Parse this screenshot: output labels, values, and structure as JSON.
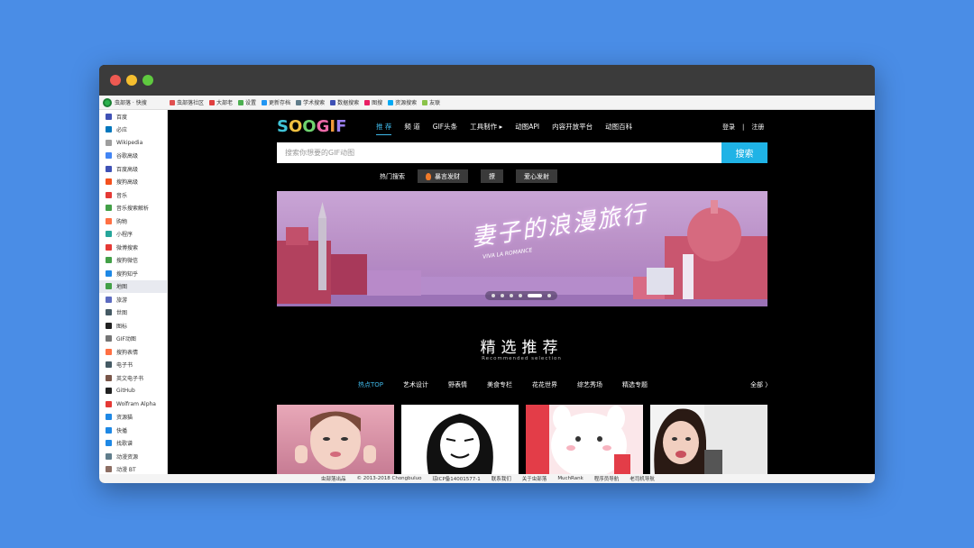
{
  "bookmarks_bar": {
    "brand_name": "虫部落 · 快搜",
    "items": [
      {
        "label": "虫部落社区",
        "color": "#e05050"
      },
      {
        "label": "大部老",
        "color": "#e04040"
      },
      {
        "label": "设置",
        "color": "#4caf50"
      },
      {
        "label": "更新存档",
        "color": "#2196f3"
      },
      {
        "label": "学术搜索",
        "color": "#607d8b"
      },
      {
        "label": "数据搜索",
        "color": "#3f51b5"
      },
      {
        "label": "图搜",
        "color": "#e91e63"
      },
      {
        "label": "资源搜索",
        "color": "#03a9f4"
      },
      {
        "label": "友联",
        "color": "#8bc34a"
      }
    ]
  },
  "sidebar": {
    "items": [
      {
        "label": "百度",
        "color": "#3f51b5"
      },
      {
        "label": "必应",
        "color": "#0277bd"
      },
      {
        "label": "Wikipedia",
        "color": "#9e9e9e"
      },
      {
        "label": "谷歌高级",
        "color": "#4285f4"
      },
      {
        "label": "百度高级",
        "color": "#3f51b5"
      },
      {
        "label": "搜狗高级",
        "color": "#f4511e"
      },
      {
        "label": "音乐",
        "color": "#e53935"
      },
      {
        "label": "音乐搜索解析",
        "color": "#43a047"
      },
      {
        "label": "购物",
        "color": "#ff7043"
      },
      {
        "label": "小程序",
        "color": "#26a69a"
      },
      {
        "label": "微博搜索",
        "color": "#e53935"
      },
      {
        "label": "搜狗微信",
        "color": "#43a047"
      },
      {
        "label": "搜狗知乎",
        "color": "#1e88e5"
      },
      {
        "label": "地图",
        "color": "#43a047",
        "active": true
      },
      {
        "label": "旅游",
        "color": "#5c6bc0"
      },
      {
        "label": "世图",
        "color": "#455a64"
      },
      {
        "label": "图标",
        "color": "#212121"
      },
      {
        "label": "GIF动图",
        "color": "#757575"
      },
      {
        "label": "搜狗表情",
        "color": "#ff7043"
      },
      {
        "label": "电子书",
        "color": "#455a64"
      },
      {
        "label": "英文电子书",
        "color": "#795548"
      },
      {
        "label": "GitHub",
        "color": "#212121"
      },
      {
        "label": "Wolfram Alpha",
        "color": "#e53935"
      },
      {
        "label": "资源猫",
        "color": "#1e88e5"
      },
      {
        "label": "快播",
        "color": "#1e88e5"
      },
      {
        "label": "找歌谱",
        "color": "#1e88e5"
      },
      {
        "label": "动漫资源",
        "color": "#607d8b"
      },
      {
        "label": "动漫 BT",
        "color": "#8d6e63"
      }
    ]
  },
  "site": {
    "logo_letters": [
      "S",
      "O",
      "O",
      "G",
      "I",
      "F"
    ],
    "nav": [
      {
        "label": "推 荐",
        "active": true
      },
      {
        "label": "频 道"
      },
      {
        "label": "GIF头条"
      },
      {
        "label": "工具制作 ▸"
      },
      {
        "label": "动图API"
      },
      {
        "label": "内容开放平台"
      },
      {
        "label": "动图百科"
      }
    ],
    "login": "登录",
    "auth_sep": "|",
    "register": "注册",
    "search_placeholder": "搜索你想要的GIF动图",
    "search_button": "搜索",
    "hot_label": "热门搜索",
    "hot_tags": [
      "暴言发财",
      "撩",
      "爱心发射"
    ]
  },
  "banner": {
    "title": "妻子的浪漫旅行",
    "subtitle": "VIVA LA ROMANCE",
    "slide_count": 6,
    "active_slide": 5
  },
  "section": {
    "title": "精选推荐",
    "subtitle": "Recommended selection",
    "categories": [
      {
        "label": "热点TOP",
        "active": true
      },
      {
        "label": "艺术设计"
      },
      {
        "label": "野表情"
      },
      {
        "label": "美食专栏"
      },
      {
        "label": "花花世界"
      },
      {
        "label": "综艺秀场"
      },
      {
        "label": "精选专题"
      }
    ],
    "all_label": "全部 〉"
  },
  "footer": {
    "items": [
      "虫部落出品",
      "© 2013-2018 Chongbuluo",
      "琼ICP备14001577-1",
      "联系我们",
      "关于虫部落",
      "MuchRank",
      "程序员导航",
      "老司机导航"
    ]
  }
}
